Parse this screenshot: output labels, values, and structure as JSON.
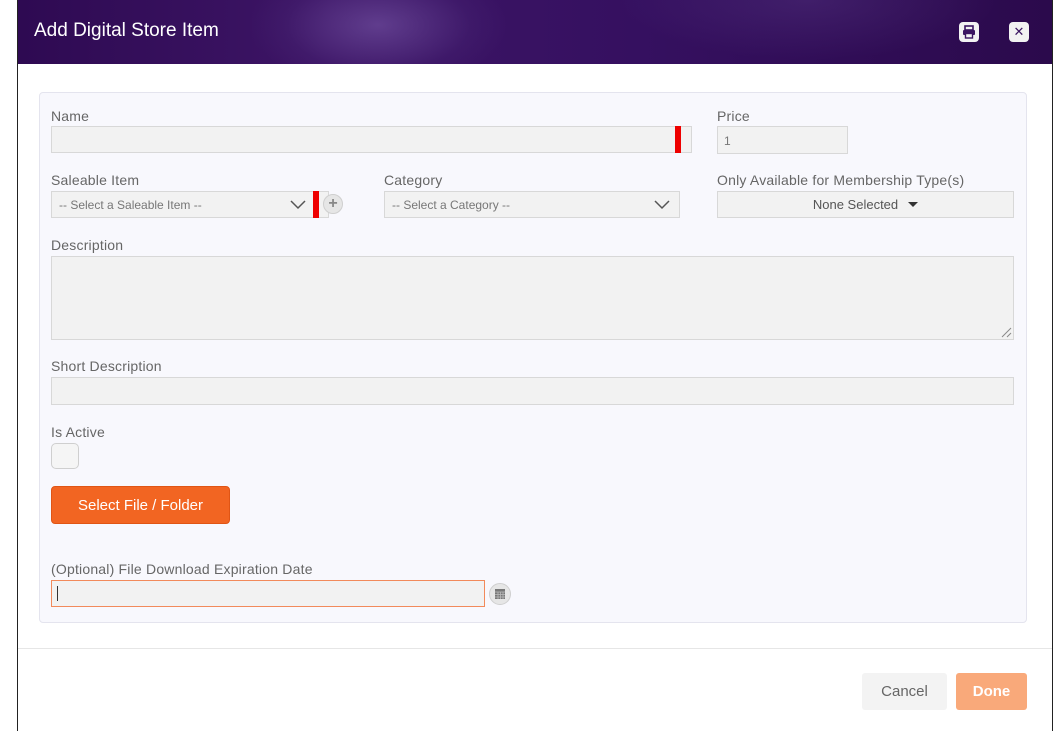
{
  "dialog": {
    "title": "Add Digital Store Item",
    "icons": {
      "print": "print-icon",
      "close": "close-icon"
    }
  },
  "form": {
    "name": {
      "label": "Name",
      "value": ""
    },
    "price": {
      "label": "Price",
      "value": "1"
    },
    "saleable_item": {
      "label": "Saleable Item",
      "selected": "-- Select a Saleable Item --"
    },
    "category": {
      "label": "Category",
      "selected": "-- Select a Category --"
    },
    "membership": {
      "label": "Only Available for Membership Type(s)",
      "selected": "None Selected"
    },
    "description": {
      "label": "Description",
      "value": ""
    },
    "short_description": {
      "label": "Short Description",
      "value": ""
    },
    "is_active": {
      "label": "Is Active",
      "checked": false
    },
    "select_file_label": "Select File / Folder",
    "expiration": {
      "label": "(Optional) File Download Expiration Date",
      "value": ""
    }
  },
  "footer": {
    "cancel_label": "Cancel",
    "done_label": "Done"
  },
  "colors": {
    "header_bg": "#35105e",
    "accent": "#f26522",
    "done_disabled": "#f9a97a",
    "required_marker": "#ee0000"
  }
}
